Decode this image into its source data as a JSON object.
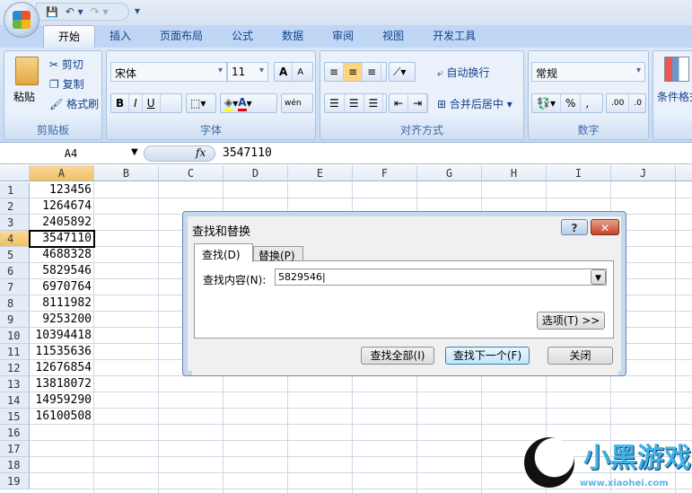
{
  "quick_access": {
    "save": "💾",
    "undo": "↶ ▾",
    "redo": "↷ ▾",
    "customize": "▾"
  },
  "tabs": [
    "开始",
    "插入",
    "页面布局",
    "公式",
    "数据",
    "审阅",
    "视图",
    "开发工具"
  ],
  "clipboard": {
    "paste": "粘贴",
    "cut": "剪切",
    "copy": "复制",
    "format_painter": "格式刷",
    "label": "剪贴板"
  },
  "font": {
    "name": "宋体",
    "size": "11",
    "grow": "A",
    "shrink": "A",
    "bold": "B",
    "italic": "I",
    "underline": "U",
    "phonetic": "wén",
    "label": "字体"
  },
  "alignment": {
    "wrap": "自动换行",
    "merge": "合并后居中",
    "label": "对齐方式"
  },
  "number": {
    "format": "常规",
    "percent": "%",
    "comma": ",",
    "inc": ".00",
    "dec": ".0",
    "label": "数字"
  },
  "styles": {
    "conditional": "条件格式"
  },
  "formula_bar": {
    "name_box": "A4",
    "fx": "fx",
    "value": "3547110"
  },
  "columns": [
    "A",
    "B",
    "C",
    "D",
    "E",
    "F",
    "G",
    "H",
    "I",
    "J"
  ],
  "rows": [
    "1",
    "2",
    "3",
    "4",
    "5",
    "6",
    "7",
    "8",
    "9",
    "10",
    "11",
    "12",
    "13",
    "14",
    "15",
    "16",
    "17",
    "18",
    "19"
  ],
  "colA": [
    "123456",
    "1264674",
    "2405892",
    "3547110",
    "4688328",
    "5829546",
    "6970764",
    "8111982",
    "9253200",
    "10394418",
    "11535636",
    "12676854",
    "13818072",
    "14959290",
    "16100508"
  ],
  "dialog": {
    "title": "查找和替换",
    "help": "?",
    "close_x": "✕",
    "tab_find": "查找(D)",
    "tab_replace": "替换(P)",
    "find_label": "查找内容(N):",
    "find_value": "5829546",
    "options": "选项(T) >>",
    "find_all": "查找全部(I)",
    "find_next": "查找下一个(F)",
    "close": "关闭"
  },
  "watermark": {
    "text": "小黑游戏",
    "url": "www.xiaohei.com"
  }
}
